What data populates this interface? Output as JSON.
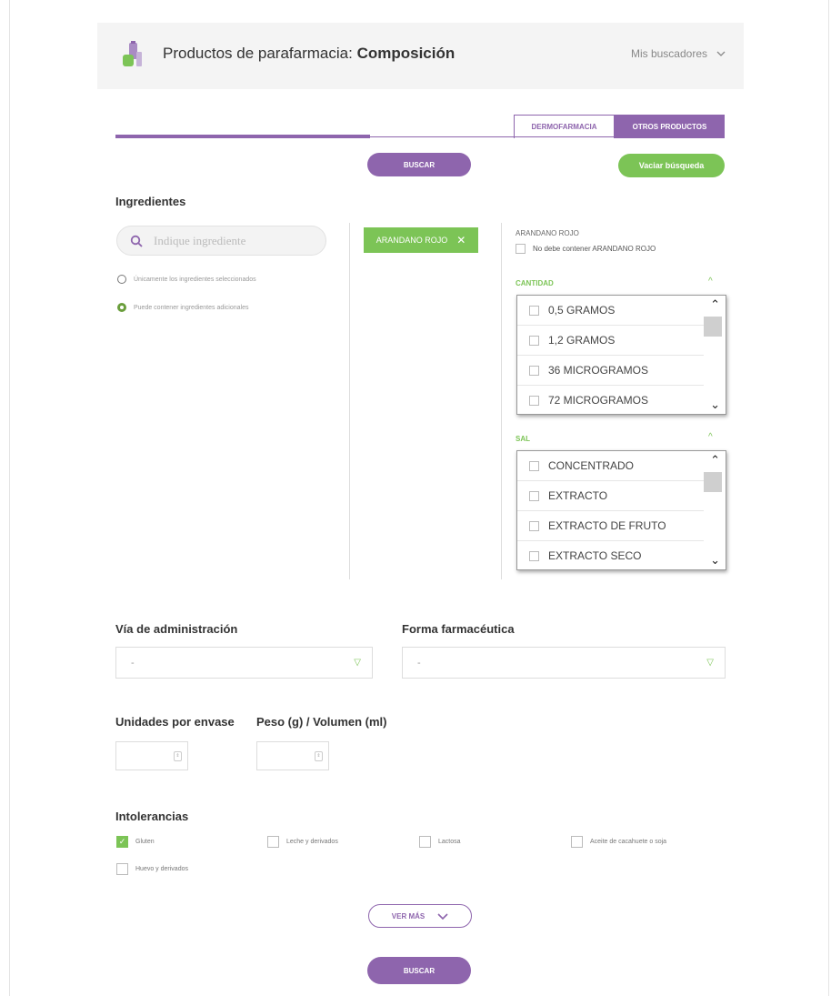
{
  "header": {
    "title_prefix": "Productos de parafarmacia: ",
    "title_bold": "Composición",
    "finders_label": "Mis buscadores"
  },
  "tabs": [
    {
      "label": "DERMOFARMACIA"
    },
    {
      "label": "OTROS PRODUCTOS"
    }
  ],
  "actions": {
    "search_top": "BUSCAR",
    "clear": "Vaciar búsqueda",
    "search_bottom": "BUSCAR",
    "see_more": "VER MÁS"
  },
  "ingredients": {
    "label": "Ingredientes",
    "search_placeholder": "Indique ingrediente",
    "radio_only": "Únicamente los ingredientes seleccionados",
    "radio_additional": "Puede contener ingredientes adicionales",
    "selected_chip": "ARANDANO ROJO",
    "selected_name": "ARANDANO ROJO",
    "exclude_label": "No debe contener ARANDANO ROJO"
  },
  "filters": {
    "cantidad": {
      "title": "CANTIDAD",
      "options": [
        "0,5 GRAMOS",
        "1,2 GRAMOS",
        "36 MICROGRAMOS",
        "72 MICROGRAMOS"
      ]
    },
    "sal": {
      "title": "SAL",
      "options": [
        "CONCENTRADO",
        "EXTRACTO",
        "EXTRACTO DE FRUTO",
        "EXTRACTO SECO"
      ]
    }
  },
  "admin": {
    "via_label": "Vía de administración",
    "via_value": "-",
    "forma_label": "Forma farmacéutica",
    "forma_value": "-"
  },
  "units": {
    "units_label": "Unidades por envase",
    "weight_label": "Peso (g) / Volumen (ml)"
  },
  "intolerances": {
    "label": "Intolerancias",
    "items": [
      {
        "label": "Gluten",
        "checked": true
      },
      {
        "label": "Leche y derivados",
        "checked": false
      },
      {
        "label": "Lactosa",
        "checked": false
      },
      {
        "label": "Aceite de cacahuete o soja",
        "checked": false
      },
      {
        "label": "Huevo y derivados",
        "checked": false
      }
    ]
  },
  "colors": {
    "purple": "#8e65ad",
    "green": "#7cc456"
  }
}
